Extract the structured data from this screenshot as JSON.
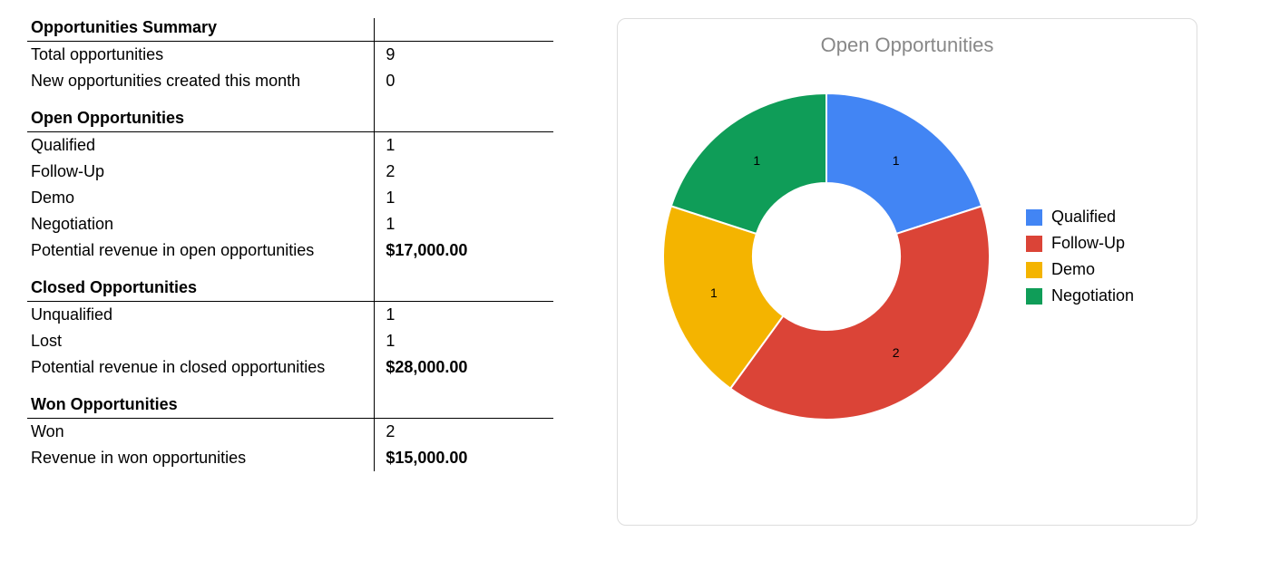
{
  "summary": {
    "sections": [
      {
        "heading": "Opportunities Summary",
        "rows": [
          {
            "label": "Total opportunities",
            "value": "9",
            "bold": false
          },
          {
            "label": "New opportunities created this month",
            "value": "0",
            "bold": false
          }
        ]
      },
      {
        "heading": "Open Opportunities",
        "rows": [
          {
            "label": "Qualified",
            "value": "1",
            "bold": false
          },
          {
            "label": "Follow-Up",
            "value": "2",
            "bold": false
          },
          {
            "label": "Demo",
            "value": "1",
            "bold": false
          },
          {
            "label": "Negotiation",
            "value": "1",
            "bold": false
          },
          {
            "label": "Potential revenue in open opportunities",
            "value": "$17,000.00",
            "bold": true
          }
        ]
      },
      {
        "heading": "Closed Opportunities",
        "rows": [
          {
            "label": "Unqualified",
            "value": "1",
            "bold": false
          },
          {
            "label": "Lost",
            "value": "1",
            "bold": false
          },
          {
            "label": "Potential revenue in closed opportunities",
            "value": "$28,000.00",
            "bold": true
          }
        ]
      },
      {
        "heading": "Won Opportunities",
        "rows": [
          {
            "label": "Won",
            "value": "2",
            "bold": false
          },
          {
            "label": "Revenue in won opportunities",
            "value": "$15,000.00",
            "bold": true
          }
        ]
      }
    ]
  },
  "chart": {
    "title": "Open Opportunities",
    "legend": [
      {
        "label": "Qualified",
        "color": "#4285F4"
      },
      {
        "label": "Follow-Up",
        "color": "#DB4437"
      },
      {
        "label": "Demo",
        "color": "#F4B400"
      },
      {
        "label": "Negotiation",
        "color": "#0F9D58"
      }
    ]
  },
  "chart_data": {
    "type": "pie",
    "title": "Open Opportunities",
    "categories": [
      "Qualified",
      "Follow-Up",
      "Demo",
      "Negotiation"
    ],
    "values": [
      1,
      2,
      1,
      1
    ],
    "colors": [
      "#4285F4",
      "#DB4437",
      "#F4B400",
      "#0F9D58"
    ],
    "donut_inner_ratio": 0.45,
    "start_angle_deg": -90,
    "direction": "clockwise",
    "legend_position": "right",
    "data_labels": "value"
  }
}
